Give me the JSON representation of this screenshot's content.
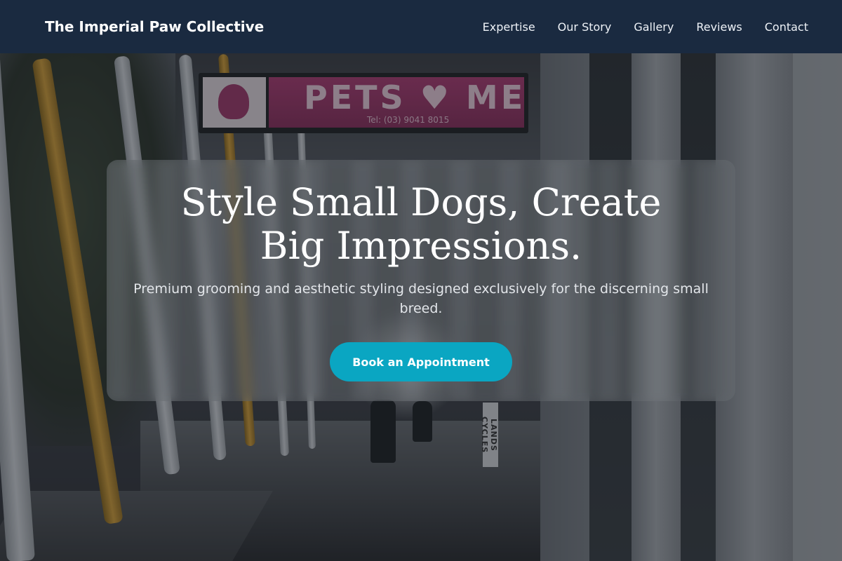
{
  "header": {
    "brand": "The Imperial Paw Collective",
    "nav": [
      "Expertise",
      "Our Story",
      "Gallery",
      "Reviews",
      "Contact"
    ]
  },
  "hero": {
    "title": "Style Small Dogs, Create Big Impressions.",
    "subtitle": "Premium grooming and aesthetic styling designed exclusively for the discerning small breed.",
    "cta_label": "Book an Appointment"
  },
  "background": {
    "sign_text": "PETS ♥ ME",
    "sign_tel": "Tel: (03) 9041 8015",
    "side_sign": "LANDS CYCLES"
  },
  "colors": {
    "header_bg": "#182840",
    "cta_bg": "#0aa6c2",
    "text_light": "#ffffff"
  }
}
